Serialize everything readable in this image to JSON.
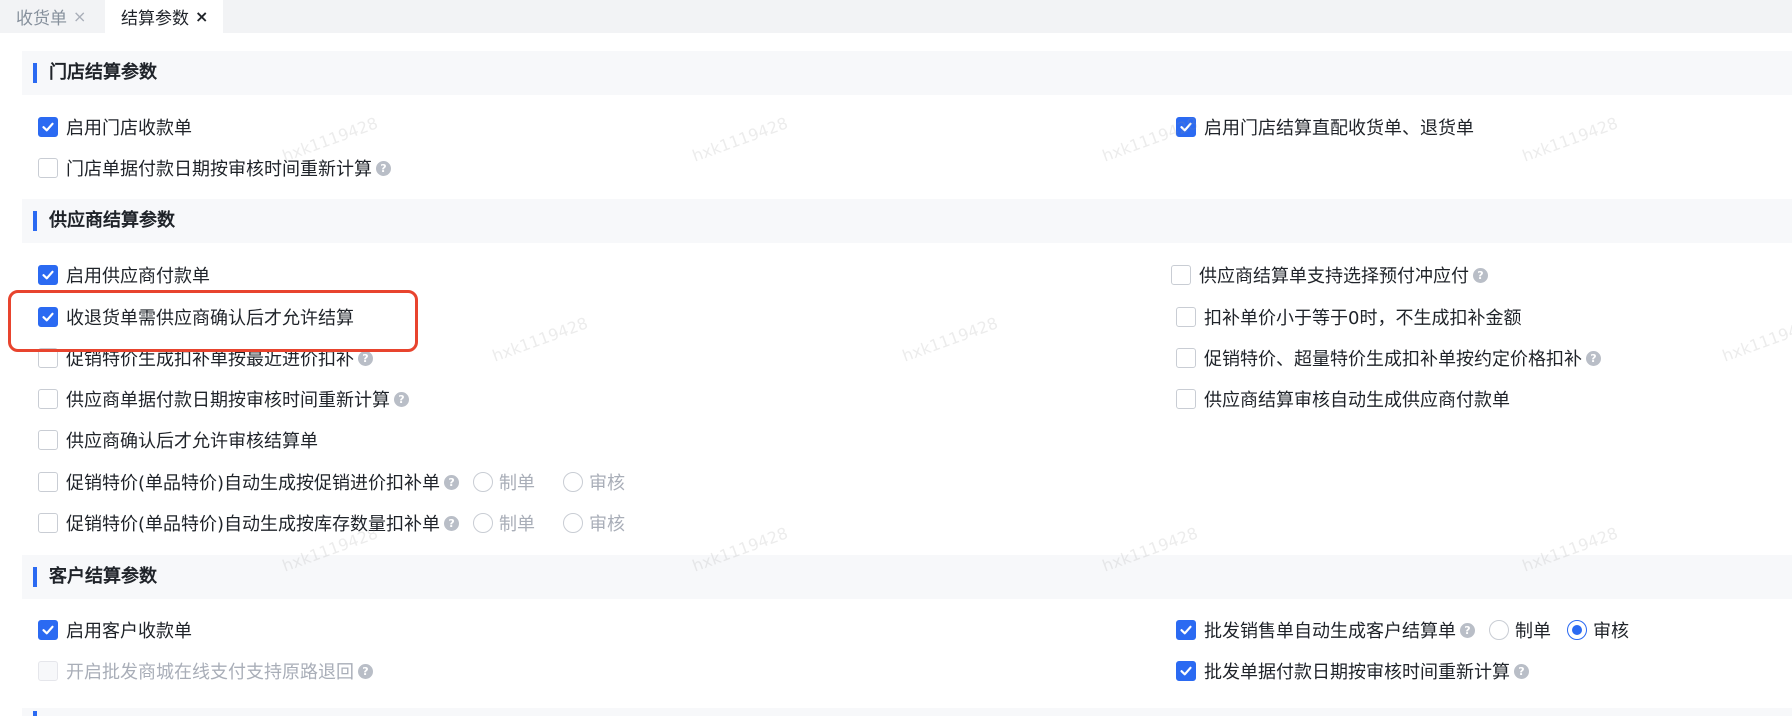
{
  "tabs": [
    {
      "label": "收货单",
      "close": "×"
    },
    {
      "label": "结算参数",
      "close": "×"
    }
  ],
  "store": {
    "title": "门店结算参数",
    "options": [
      {
        "label": "启用门店收款单",
        "checked": true
      },
      {
        "label": "启用门店结算直配收货单、退货单",
        "checked": true
      },
      {
        "label": "门店单据付款日期按审核时间重新计算",
        "checked": false,
        "help": true
      }
    ]
  },
  "supplier": {
    "title": "供应商结算参数",
    "options": [
      {
        "label": "启用供应商付款单",
        "checked": true
      },
      {
        "label": "供应商结算单支持选择预付冲应付",
        "checked": false,
        "help": true
      },
      {
        "label": "收退货单需供应商确认后才允许结算",
        "checked": true
      },
      {
        "label": "扣补单价小于等于0时，不生成扣补金额",
        "checked": false
      },
      {
        "label": "促销特价生成扣补单按最近进价扣补",
        "checked": false,
        "help": true
      },
      {
        "label": "促销特价、超量特价生成扣补单按约定价格扣补",
        "checked": false,
        "help": true
      },
      {
        "label": "供应商单据付款日期按审核时间重新计算",
        "checked": false,
        "help": true
      },
      {
        "label": "供应商结算审核自动生成供应商付款单",
        "checked": false
      },
      {
        "label": "供应商确认后才允许审核结算单",
        "checked": false
      },
      {
        "label": "促销特价(单品特价)自动生成按促销进价扣补单",
        "checked": false,
        "help": true
      },
      {
        "label": "促销特价(单品特价)自动生成按库存数量扣补单",
        "checked": false,
        "help": true
      }
    ],
    "radio_make": "制单",
    "radio_audit": "审核"
  },
  "customer": {
    "title": "客户结算参数",
    "options": [
      {
        "label": "启用客户收款单",
        "checked": true
      },
      {
        "label": "批发销售单自动生成客户结算单",
        "checked": true,
        "help": true
      },
      {
        "label": "开启批发商城在线支付支持原路退回",
        "checked": false,
        "help": true,
        "disabled": true
      },
      {
        "label": "批发单据付款日期按审核时间重新计算",
        "checked": true,
        "help": true
      }
    ],
    "radio_make": "制单",
    "radio_audit": "审核",
    "radio_selected": "审核"
  },
  "help_glyph": "?",
  "watermark": "hxk1119428",
  "colors": {
    "accent": "#2b6af2",
    "highlight": "#e8442e",
    "muted": "#a9aeb8"
  }
}
